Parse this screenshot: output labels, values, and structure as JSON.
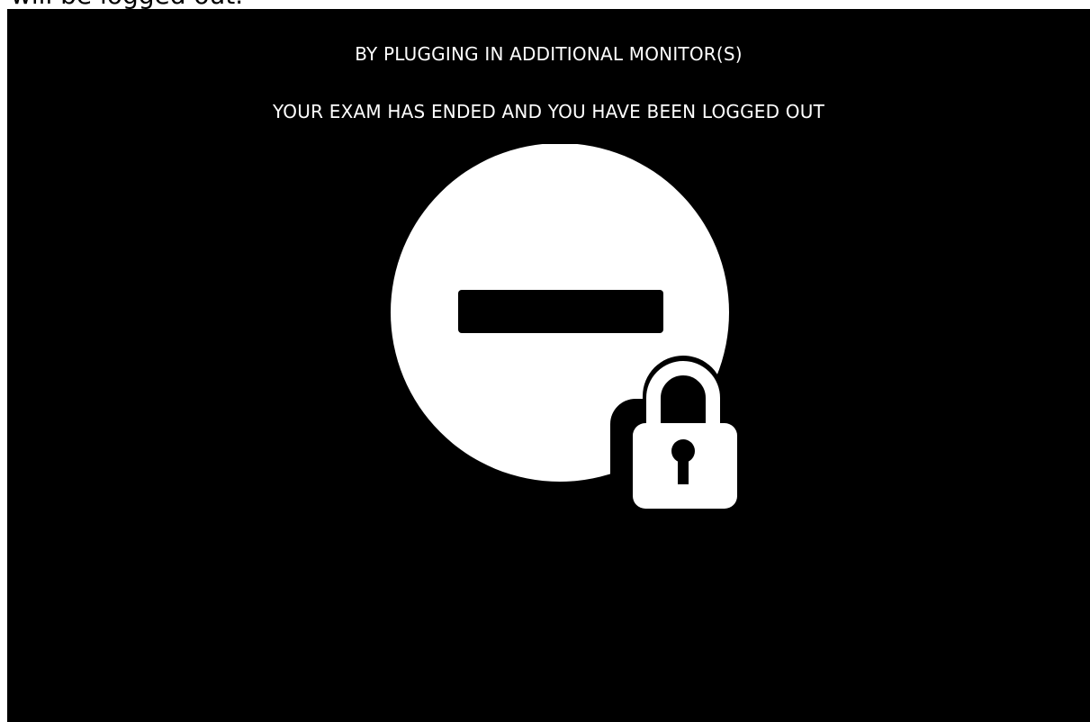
{
  "top_partial_text": "will be logged out.",
  "message": {
    "line1": "BY PLUGGING IN ADDITIONAL MONITOR(S)",
    "line2": "YOUR EXAM HAS ENDED AND YOU HAVE BEEN LOGGED OUT"
  },
  "icons": {
    "main": "no-entry-icon",
    "overlay": "padlock-icon"
  },
  "colors": {
    "background": "#000000",
    "foreground": "#ffffff"
  }
}
